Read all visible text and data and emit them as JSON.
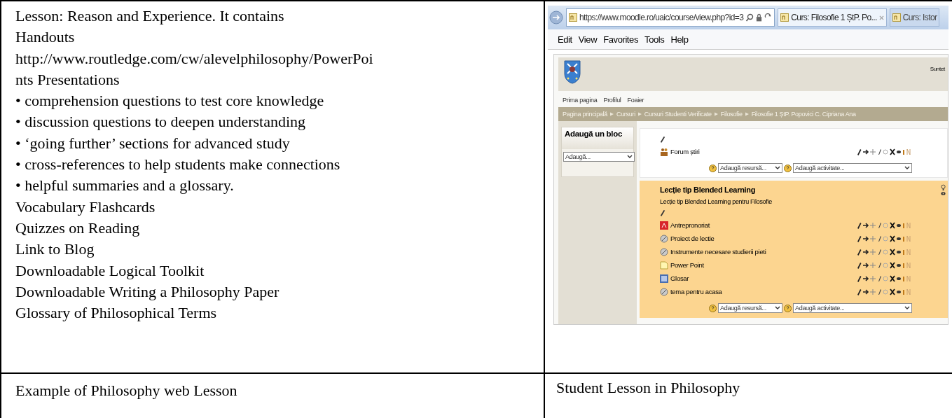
{
  "left_cell": {
    "lines": [
      "Lesson: Reason and Experience. It contains",
      "Handouts",
      "http://www.routledge.com/cw/alevelphilosophy/PowerPoi",
      "nts Presentations",
      "• comprehension questions to test core knowledge",
      "• discussion questions to deepen understanding",
      "• ‘going further’ sections for advanced study",
      "• cross-references to help students make connections",
      "• helpful summaries and a glossary.",
      "Vocabulary Flashcards",
      "Quizzes on Reading",
      "Link to Blog",
      "Downloadable Logical Toolkit",
      "Downloadable Writing a Philosophy Paper",
      "Glossary of Philosophical Terms"
    ]
  },
  "screenshot": {
    "address": "https://www.moodle.ro/uaic/course/view.php?id=3",
    "tabs": [
      {
        "label": "Curs: Filosofie 1 ȘtP. Po...",
        "selected": true
      },
      {
        "label": "Curs: Istor",
        "selected": false
      }
    ],
    "menu": [
      "Edit",
      "View",
      "Favorites",
      "Tools",
      "Help"
    ],
    "header_text": "Suntet",
    "nav": [
      "Prima pagina",
      "Profilul",
      "Foaier"
    ],
    "breadcrumb": [
      "Pagina principală",
      "Cursuri",
      "Cursuri Studenti Verificate",
      "Filosofie",
      "Filosofie 1 ȘtP. Popovici C. Cipriana Ana"
    ],
    "block": {
      "title": "Adaugă un bloc",
      "select": "Adaugă..."
    },
    "sections": [
      {
        "highlighted": false,
        "items": [
          {
            "kind": "forum",
            "label": "Forum știri"
          }
        ],
        "add_resource": "Adaugă resursă...",
        "add_activity": "Adaugă activitate..."
      },
      {
        "highlighted": true,
        "title": "Lecție tip Blended Learning",
        "summary": "Lecție tip Blended Learning pentru Filosofie",
        "items": [
          {
            "kind": "pdf",
            "label": "Antrepronoriat"
          },
          {
            "kind": "url",
            "label": "Proiect de lectie"
          },
          {
            "kind": "url",
            "label": "Instrumente necesare studierii pieti"
          },
          {
            "kind": "file",
            "label": "Power Point"
          },
          {
            "kind": "glossary",
            "label": "Glosar"
          },
          {
            "kind": "url",
            "label": "tema pentru acasa"
          }
        ],
        "add_resource": "Adaugă resursă...",
        "add_activity": "Adaugă activitate..."
      }
    ]
  },
  "captions": [
    "Example of Philosophy web Lesson",
    "Student Lesson in Philosophy"
  ]
}
